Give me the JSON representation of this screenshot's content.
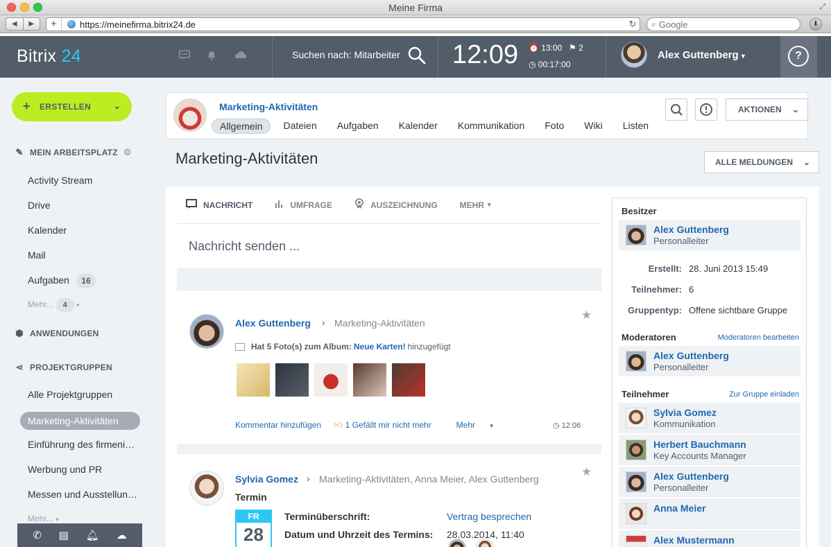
{
  "browser": {
    "window_title": "Meine Firma",
    "url": "https://meinefirma.bitrix24.de",
    "search_placeholder": "Google"
  },
  "header": {
    "logo_text": "Bitrix",
    "logo_number": "24",
    "search_label": "Suchen nach: Mitarbeiter",
    "clock": "12:09",
    "alarm_time": "13:00",
    "flag_count": "2",
    "timer": "00:17:00",
    "user_name": "Alex Guttenberg",
    "help_label": "?"
  },
  "sidebar": {
    "create_label": "ERSTELLEN",
    "workspace_heading": "MEIN ARBEITSPLATZ",
    "workspace_items": [
      {
        "label": "Activity Stream"
      },
      {
        "label": "Drive"
      },
      {
        "label": "Kalender"
      },
      {
        "label": "Mail"
      },
      {
        "label": "Aufgaben",
        "count": "16"
      }
    ],
    "more_label": "Mehr...",
    "more_count": "4",
    "apps_heading": "ANWENDUNGEN",
    "groups_heading": "PROJEKTGRUPPEN",
    "group_items": [
      {
        "label": "Alle Projektgruppen"
      },
      {
        "label": "Marketing-Aktivitäten"
      },
      {
        "label": "Einführung des firmeni…"
      },
      {
        "label": "Werbung und PR"
      },
      {
        "label": "Messen und Ausstellun…"
      }
    ],
    "groups_more_label": "Mehr..."
  },
  "group": {
    "name": "Marketing-Aktivitäten",
    "tabs": [
      {
        "label": "Allgemein"
      },
      {
        "label": "Dateien"
      },
      {
        "label": "Aufgaben"
      },
      {
        "label": "Kalender"
      },
      {
        "label": "Kommunikation"
      },
      {
        "label": "Foto"
      },
      {
        "label": "Wiki"
      },
      {
        "label": "Listen"
      }
    ],
    "actions_label": "AKTIONEN"
  },
  "page": {
    "title": "Marketing-Aktivitäten",
    "all_messages_label": "ALLE MELDUNGEN"
  },
  "composer": {
    "tabs": [
      {
        "label": "NACHRICHT"
      },
      {
        "label": "UMFRAGE"
      },
      {
        "label": "AUSZEICHNUNG"
      },
      {
        "label": "MEHR"
      }
    ],
    "placeholder": "Nachricht senden ..."
  },
  "posts": [
    {
      "author": "Alex Guttenberg",
      "destination": "Marketing-Aktivitäten",
      "text_before": "Hat 5 Foto(s) zum Album:",
      "album": "Neue Karten!",
      "text_after": "hinzugefügt",
      "comment_label": "Kommentar hinzufügen",
      "like_label": "1  Gefällt mir nicht mehr",
      "more_label": "Mehr",
      "time": "12:06"
    },
    {
      "author": "Sylvia Gomez",
      "destination": "Marketing-Aktivitäten, Anna Meier, Alex Guttenberg",
      "event_title": "Termin",
      "cal_day_name": "FR",
      "cal_day": "28",
      "subject_label": "Terminüberschrift:",
      "subject_value": "Vertrag besprechen",
      "datetime_label": "Datum und Uhrzeit des Termins:",
      "datetime_value": "28.03.2014, 11:40"
    }
  ],
  "info": {
    "owner_heading": "Besitzer",
    "owner": {
      "name": "Alex Guttenberg",
      "role": "Personalleiter"
    },
    "created_label": "Erstellt:",
    "created_value": "28. Juni 2013 15:49",
    "members_label": "Teilnehmer:",
    "members_value": "6",
    "type_label": "Gruppentyp:",
    "type_value": "Offene sichtbare Gruppe",
    "moderators_heading": "Moderatoren",
    "moderators_edit_link": "Moderatoren bearbeiten",
    "moderator": {
      "name": "Alex Guttenberg",
      "role": "Personalleiter"
    },
    "participants_heading": "Teilnehmer",
    "invite_link": "Zur Gruppe einladen",
    "participants": [
      {
        "name": "Sylvia Gomez",
        "role": "Kommunikation"
      },
      {
        "name": "Herbert Bauchmann",
        "role": "Key Accounts Manager"
      },
      {
        "name": "Alex Guttenberg",
        "role": "Personalleiter"
      },
      {
        "name": "Anna Meier",
        "role": ""
      },
      {
        "name": "Alex Mustermann",
        "role": ""
      }
    ]
  },
  "colors": {
    "header_bg": "#535c69",
    "accent_blue": "#2067b0",
    "create_button": "#bbed21",
    "logo_accent": "#2fc6f6"
  }
}
